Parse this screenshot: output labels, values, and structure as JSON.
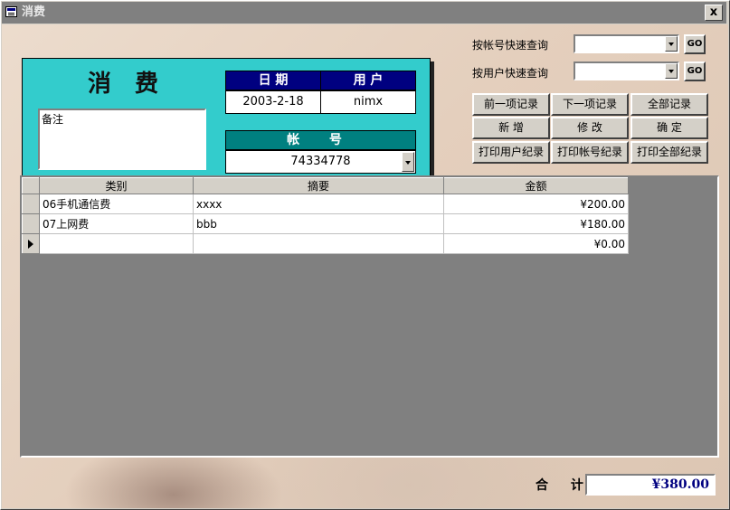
{
  "window": {
    "title": "消费",
    "close_label": "x"
  },
  "form": {
    "heading": "消费",
    "memo_label": "备注",
    "date_header": "日 期",
    "date_value": "2003-2-18",
    "user_header": "用 户",
    "user_value": "nimx",
    "account_header": "帐 号",
    "account_value": "74334778"
  },
  "quick_search": {
    "by_account_label": "按帐号快速查询",
    "by_account_value": "",
    "by_user_label": "按用户快速查询",
    "by_user_value": "",
    "go_label": "GO"
  },
  "buttons": {
    "prev": "前一项记录",
    "next": "下一项记录",
    "all": "全部记录",
    "add": "新 增",
    "edit": "修 改",
    "ok": "确 定",
    "print_user": "打印用户纪录",
    "print_account": "打印帐号纪录",
    "print_all": "打印全部纪录"
  },
  "grid": {
    "columns": [
      "类别",
      "摘要",
      "金额"
    ],
    "rows": [
      {
        "category": "06手机通信费",
        "summary": "xxxx",
        "amount": "¥200.00"
      },
      {
        "category": "07上网费",
        "summary": "bbb",
        "amount": "¥180.00"
      },
      {
        "category": "",
        "summary": "",
        "amount": "¥0.00"
      }
    ]
  },
  "total": {
    "label": "合 计:",
    "value": "¥380.00"
  }
}
